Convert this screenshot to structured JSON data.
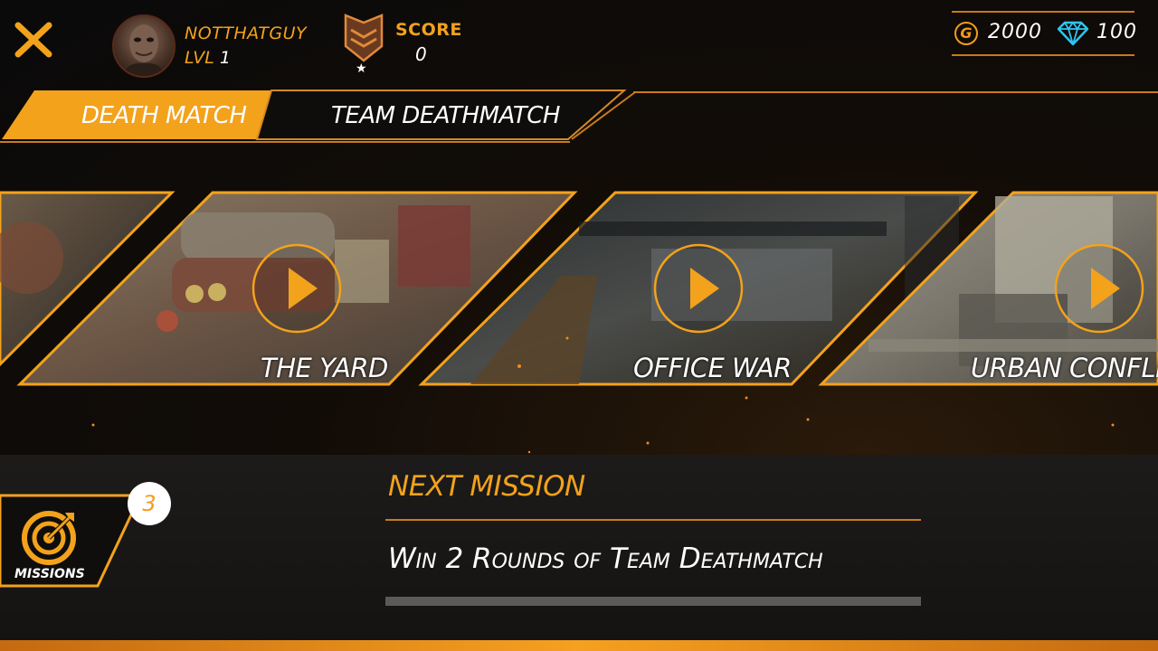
{
  "header": {
    "close_icon": "close-x-icon",
    "player_name": "NOTTHATGUY",
    "level_label": "LVL",
    "level_value": "1",
    "rank_icon": "chevron-rank-icon",
    "score_label": "SCORE",
    "score_value": "0",
    "gold_symbol": "G",
    "gold_value": "2000",
    "gem_icon": "diamond-icon",
    "gem_value": "100"
  },
  "tabs": [
    {
      "label": "DEATH MATCH",
      "active": true
    },
    {
      "label": "TEAM DEATHMATCH",
      "active": false
    }
  ],
  "maps": [
    {
      "label": "THE YARD",
      "play_icon": "play-icon"
    },
    {
      "label": "OFFICE WAR",
      "play_icon": "play-icon"
    },
    {
      "label": "URBAN CONFLIC",
      "play_icon": "play-icon"
    }
  ],
  "missions": {
    "label": "MISSIONS",
    "icon": "target-icon",
    "badge_count": "3",
    "next_title": "NEXT MISSION",
    "next_text": "Win 2 Rounds of Team Deathmatch",
    "progress": 0
  },
  "colors": {
    "accent": "#f3a21c",
    "background": "#0a0a0a",
    "gem": "#2ec5f0"
  }
}
